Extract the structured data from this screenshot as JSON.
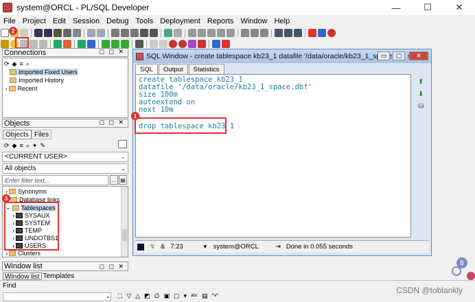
{
  "window": {
    "title": "system@ORCL - PL/SQL Developer",
    "minimize": "—",
    "maximize": "☐",
    "close": "✕"
  },
  "menu": [
    "File",
    "Project",
    "Edit",
    "Session",
    "Debug",
    "Tools",
    "Deployment",
    "Reports",
    "Window",
    "Help"
  ],
  "connections": {
    "title": "Connections",
    "items": [
      "Imported Fixed Users",
      "Imported History",
      "Recent"
    ]
  },
  "objects": {
    "title": "Objects",
    "tabs": [
      "Objects",
      "Files"
    ],
    "user_select": "<CURRENT USER>",
    "view_select": "All objects",
    "filter_placeholder": "Enter filter text...",
    "tree": [
      "Synonyms",
      "Database links",
      "Tablespaces",
      "SYSAUX",
      "SYSTEM",
      "TEMP",
      "UNDOTBS1",
      "USERS",
      "Clusters"
    ]
  },
  "window_list": {
    "title": "Window list",
    "tabs": [
      "Window list",
      "Templates"
    ]
  },
  "sql_window": {
    "title": "SQL Window - create tablespace kb23_1 datafile '/data/oracle/kb23_1_space.dbf' s...",
    "tabs": [
      "SQL",
      "Output",
      "Statistics"
    ],
    "code": [
      "create tablespace kb23_1",
      "datafile '/data/oracle/kb23_1_space.dbf'",
      "size 100m",
      "autoextend on",
      "next 10m",
      "",
      "drop tablespace kb23_1"
    ],
    "status": {
      "position": "7:23",
      "connection": "system@ORCL",
      "message": "Done in 0.055 seconds"
    }
  },
  "find": {
    "label": "Find"
  },
  "badges": [
    "1",
    "2",
    "3"
  ],
  "watermark": "CSDN @toblankly",
  "colors": {
    "annotation_red": "#e03030",
    "code_teal": "#1a7f9f"
  }
}
